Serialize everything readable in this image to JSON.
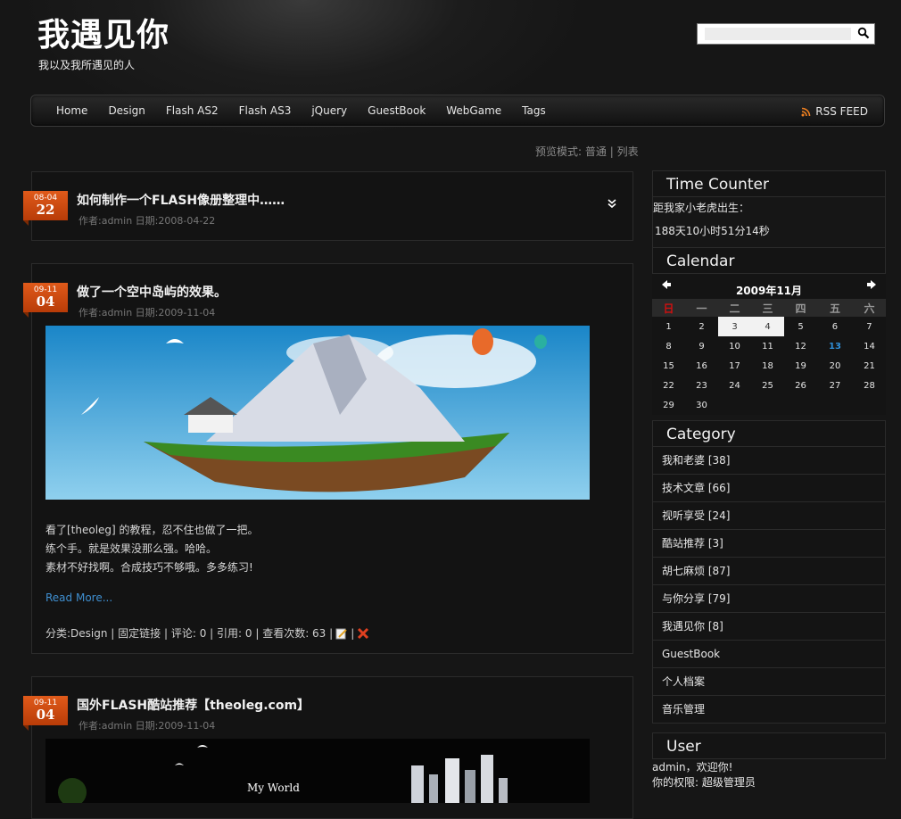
{
  "header": {
    "title": "我遇见你",
    "subtitle": "我以及我所遇见的人",
    "search_placeholder": ""
  },
  "nav": {
    "items": [
      "Home",
      "Design",
      "Flash AS2",
      "Flash AS3",
      "jQuery",
      "GuestBook",
      "WebGame",
      "Tags"
    ],
    "rss_label": "RSS FEED"
  },
  "view_mode": {
    "label": "预览模式:",
    "normal": "普通",
    "sep": " | ",
    "list": "列表"
  },
  "posts": [
    {
      "month_day": "08-04",
      "day": "22",
      "title": "如何制作一个FLASH像册整理中……",
      "meta": "作者:admin  日期:2008-04-22"
    },
    {
      "month_day": "09-11",
      "day": "04",
      "title": "做了一个空中岛屿的效果。",
      "meta": "作者:admin  日期:2009-11-04",
      "body": [
        "看了[theoleg] 的教程，忍不住也做了一把。",
        "练个手。就是效果没那么强。哈哈。",
        "素材不好找啊。合成技巧不够哦。多多练习!"
      ],
      "read_more": "Read More...",
      "footer": {
        "category": "分类:Design",
        "permalink": "固定链接",
        "comments": "评论: 0",
        "trackbacks": "引用: 0",
        "views": "查看次数: 63"
      }
    },
    {
      "month_day": "09-11",
      "day": "04",
      "title": "国外FLASH酷站推荐【theoleg.com】",
      "meta": "作者:admin  日期:2009-11-04",
      "image_caption": "My World"
    }
  ],
  "sidebar": {
    "time_counter": {
      "title": "Time Counter",
      "line1": "距我家小老虎出生：",
      "line2": "188天10小时51分14秒"
    },
    "calendar": {
      "title": "Calendar",
      "month": "2009年11月",
      "weekdays": [
        "日",
        "一",
        "二",
        "三",
        "四",
        "五",
        "六"
      ],
      "weeks": [
        [
          "1",
          "2",
          "3",
          "4",
          "5",
          "6",
          "7"
        ],
        [
          "8",
          "9",
          "10",
          "11",
          "12",
          "13",
          "14"
        ],
        [
          "15",
          "16",
          "17",
          "18",
          "19",
          "20",
          "21"
        ],
        [
          "22",
          "23",
          "24",
          "25",
          "26",
          "27",
          "28"
        ],
        [
          "29",
          "30",
          "",
          "",
          "",
          "",
          ""
        ]
      ],
      "highlighted": [
        "3",
        "4"
      ],
      "today": "13"
    },
    "category": {
      "title": "Category",
      "items": [
        "我和老婆 [38]",
        "技术文章 [66]",
        "视听享受 [24]",
        "酷站推荐 [3]",
        "胡七麻烦 [87]",
        "与你分享 [79]",
        "我遇见你 [8]",
        "GuestBook",
        "个人档案",
        "音乐管理"
      ]
    },
    "user": {
      "title": "User",
      "line1": "admin，欢迎你!",
      "line2": "你的权限: 超级管理员"
    }
  },
  "colors": {
    "accent": "#d24a12",
    "link": "#3f8fd0",
    "sunday": "#d01010",
    "today": "#2f8fd8"
  }
}
